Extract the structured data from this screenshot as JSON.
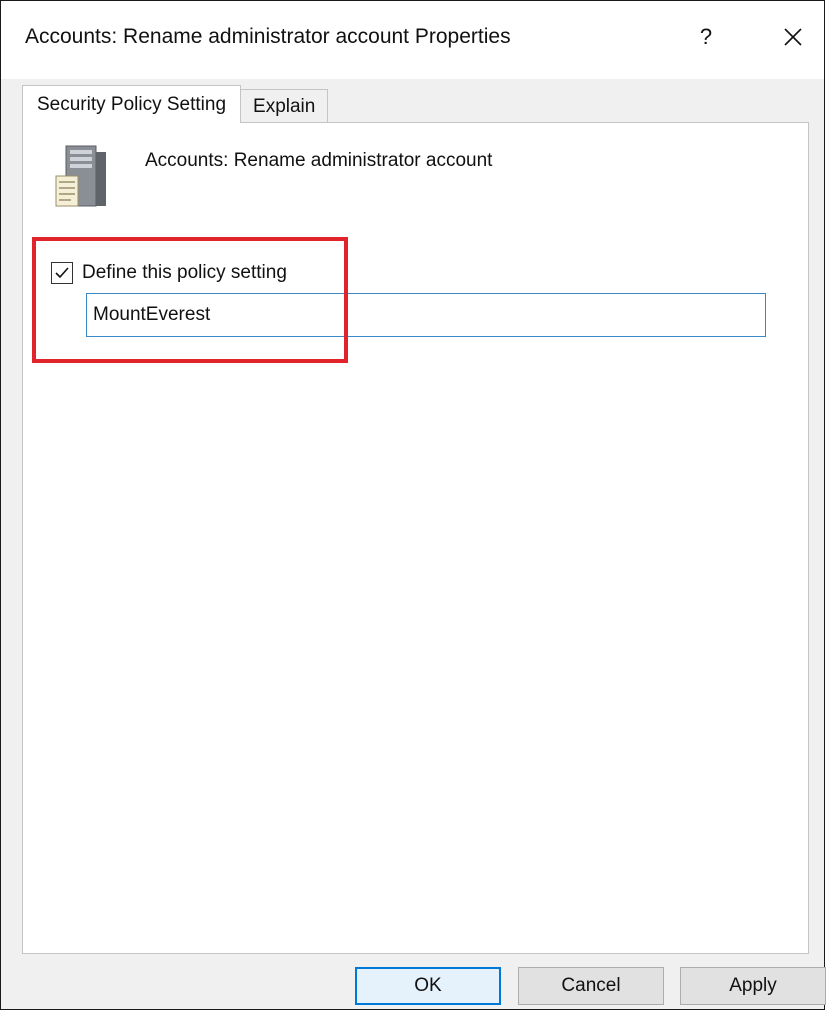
{
  "window": {
    "title": "Accounts: Rename administrator account Properties",
    "help_label": "?",
    "close_icon": "close-icon"
  },
  "tabs": [
    {
      "label": "Security Policy Setting",
      "active": true
    },
    {
      "label": "Explain",
      "active": false
    }
  ],
  "policy": {
    "icon": "server-document-icon",
    "name": "Accounts: Rename administrator account"
  },
  "define_setting": {
    "label": "Define this policy setting",
    "checked": true,
    "value": "MountEverest"
  },
  "buttons": {
    "ok": "OK",
    "cancel": "Cancel",
    "apply": "Apply"
  },
  "colors": {
    "highlight": "#e0242a",
    "focus_border": "#0078d7",
    "input_border": "#3a88c8"
  }
}
